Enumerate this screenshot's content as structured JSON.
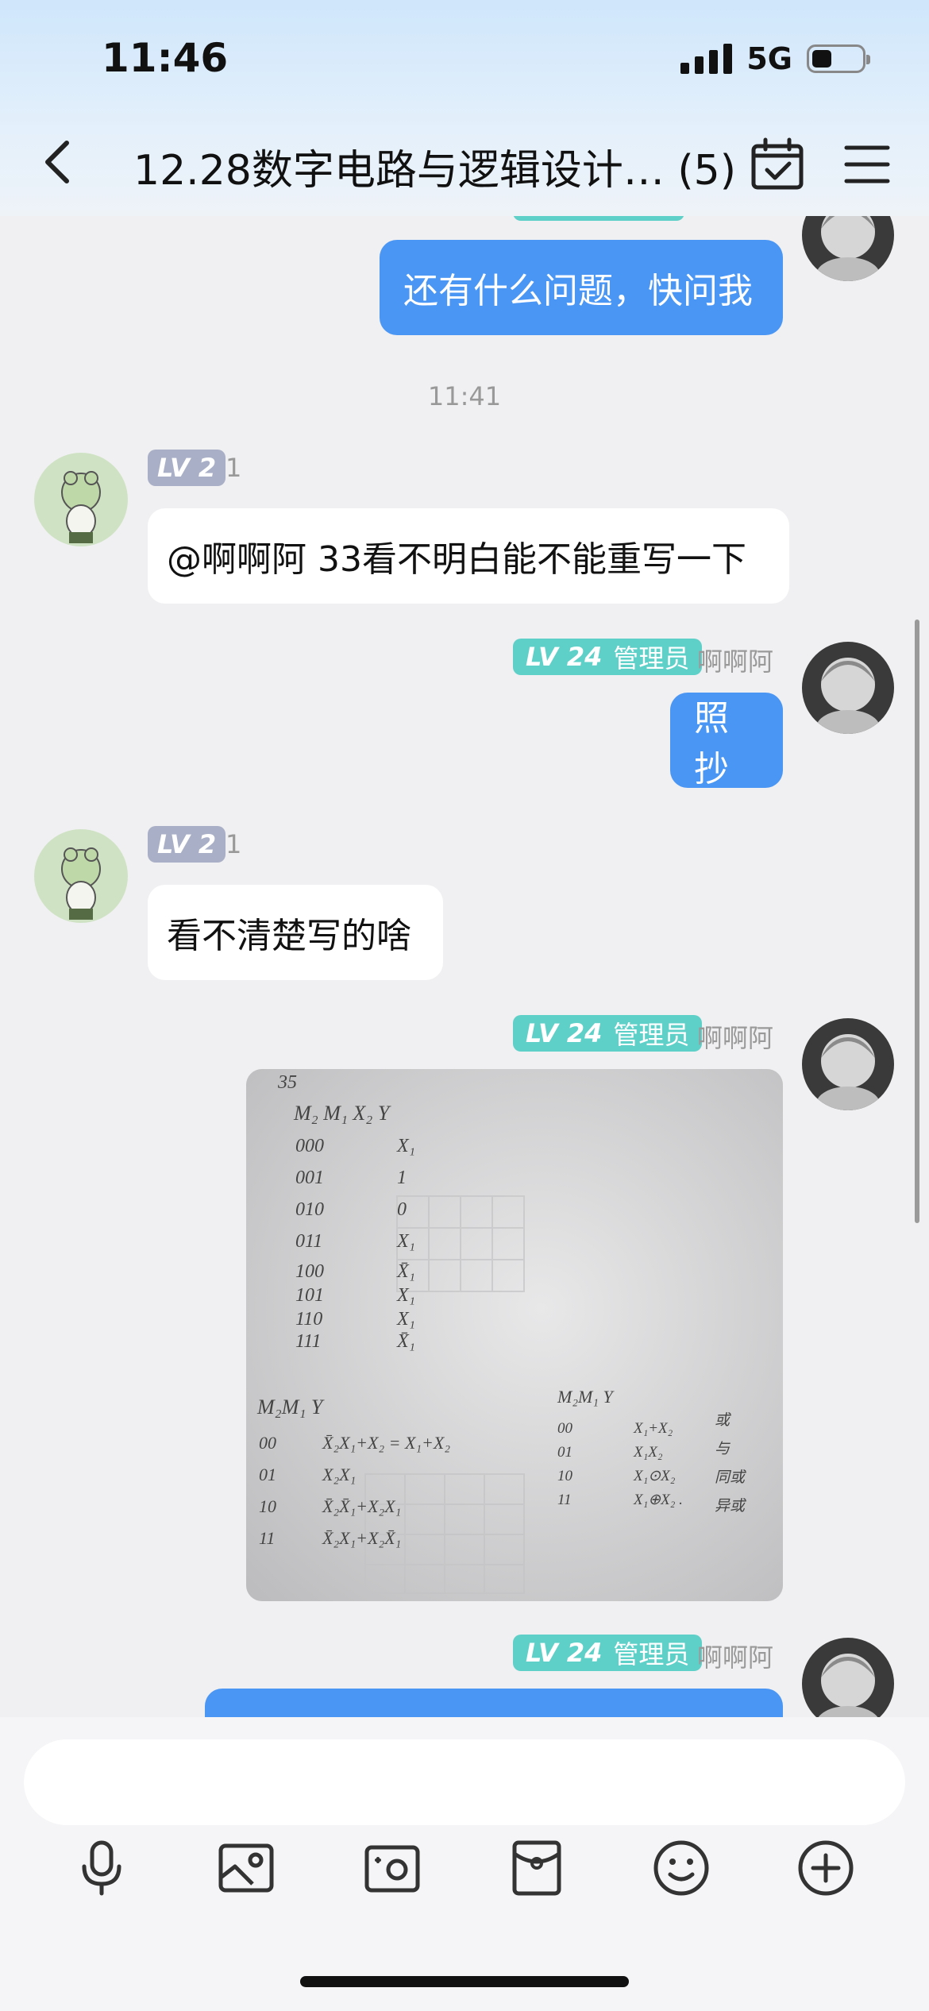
{
  "status_bar": {
    "time": "11:46",
    "network": "5G"
  },
  "header": {
    "title": "12.28数字电路与逻辑设计… (5)"
  },
  "messages": [
    {
      "text": "还有什么问题，快问我"
    },
    {
      "time": "11:41"
    },
    {
      "level": "LV 2",
      "sender_num": "1",
      "text": "@啊啊阿 33看不明白能不能重写一下"
    },
    {
      "level": "LV 24",
      "role": "管理员",
      "name": "啊啊阿",
      "text": "照抄"
    },
    {
      "level": "LV 2",
      "sender_num": "1",
      "text": "看不清楚写的啥"
    },
    {
      "level": "LV 24",
      "role": "管理员",
      "name": "啊啊阿"
    },
    {
      "level": "LV 24",
      "role": "管理员",
      "name": "啊啊阿"
    }
  ],
  "handwriting": {
    "problem": "35",
    "header_row": "M₂ M₁ X₂    Y",
    "rows": [
      [
        "000",
        "X₁"
      ],
      [
        "001",
        "1"
      ],
      [
        "010",
        "0"
      ],
      [
        "011",
        "X₁"
      ],
      [
        "100",
        "X̄₁"
      ],
      [
        "101",
        "X₁"
      ],
      [
        "110",
        "X₁"
      ],
      [
        "111",
        "X̄₁"
      ]
    ],
    "table2_header": "M₂M₁   Y",
    "table2_rows": [
      [
        "00",
        "X̄₂X₁+X₂ = X₁+X₂"
      ],
      [
        "01",
        "X₂X₁"
      ],
      [
        "10",
        "X̄₂X̄₁+X₂X₁"
      ],
      [
        "11",
        "X̄₂X₁+X₂X̄₁"
      ]
    ],
    "table3_header": "M₂M₁     Y",
    "table3_rows": [
      [
        "00",
        "X₁+X₂",
        "或"
      ],
      [
        "01",
        "X₁X₂",
        "与"
      ],
      [
        "10",
        "X₁⊙X₂",
        "同或"
      ],
      [
        "11",
        "X₁⊕X₂ .",
        "异或"
      ]
    ]
  },
  "colors": {
    "outgoing_bubble": "#4a96f5",
    "admin_badge": "#5fd0c8",
    "member_badge": "#a9afc6"
  },
  "toolbar_icons": [
    "microphone-icon",
    "image-icon",
    "camera-icon",
    "red-packet-icon",
    "emoji-icon",
    "plus-icon"
  ]
}
